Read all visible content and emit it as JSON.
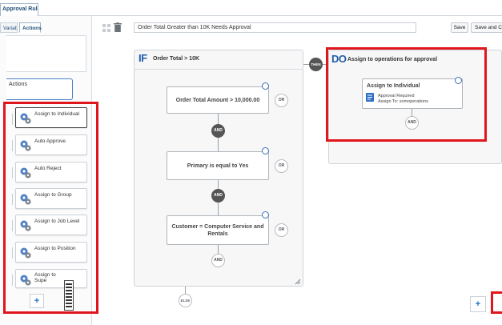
{
  "top_tab": {
    "label": "Approval Rules"
  },
  "left_panel": {
    "tabs": [
      {
        "label": "Variables",
        "active": false
      },
      {
        "label": "Actions",
        "active": true
      }
    ],
    "section_label": "Actions",
    "actions": [
      {
        "label": "Assign to Individual",
        "selected": true,
        "icon": "gears-icon"
      },
      {
        "label": "Auto Approve",
        "icon": "gears-icon"
      },
      {
        "label": "Auto Reject",
        "icon": "gears-icon"
      },
      {
        "label": "Assign to Group",
        "icon": "gears-icon"
      },
      {
        "label": "Assign to Job Level",
        "icon": "gears-icon"
      },
      {
        "label": "Assign to Position",
        "icon": "gears-icon"
      },
      {
        "label_line1": "Assign to",
        "label_line2": "Supe",
        "icon": "gears-icon"
      }
    ],
    "add_label": "+"
  },
  "toolbar": {
    "rule_name": "Order Total Greater than 10K Needs Approval",
    "save_label": "Save",
    "save_close_label": "Save and Close"
  },
  "if_block": {
    "keyword": "IF",
    "title": "Order Total > 10K",
    "conditions": [
      {
        "text": "Order Total Amount > 10,000.00"
      },
      {
        "text": "Primary is equal to Yes"
      },
      {
        "text_line1": "Customer = Computer Service and",
        "text_line2": "Rentals"
      }
    ],
    "or_label": "OR",
    "and_label": "AND"
  },
  "then_label": "THEN",
  "else_label": "ELSE",
  "do_block": {
    "keyword": "DO",
    "title": "Assign to operations for approval",
    "action": {
      "title": "Assign to Individual",
      "line1": "Approval Required",
      "line2": "Assign To: somoperations"
    },
    "and_label": "AND"
  },
  "canvas_add_label": "+",
  "colors": {
    "highlight": "#e0161d",
    "keyword_blue": "#1f5da8",
    "link_blue": "#1f6fbf"
  }
}
